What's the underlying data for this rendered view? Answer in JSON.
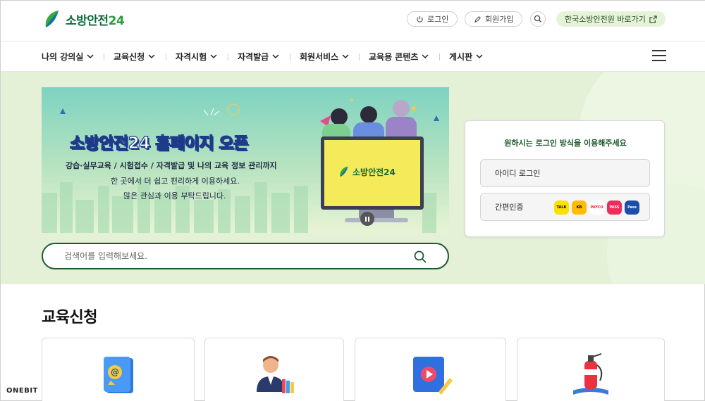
{
  "brand": {
    "name_ko": "소방안전",
    "name_num": "24"
  },
  "header": {
    "login_label": "로그인",
    "signup_label": "회원가입",
    "external_link_label": "한국소방안전원 바로가기"
  },
  "nav": {
    "items": [
      {
        "label": "나의 강의실"
      },
      {
        "label": "교육신청"
      },
      {
        "label": "자격시험"
      },
      {
        "label": "자격발급"
      },
      {
        "label": "회원서비스"
      },
      {
        "label": "교육용 콘텐츠"
      },
      {
        "label": "게시판"
      }
    ]
  },
  "banner": {
    "title": "소방안전24 홈페이지 오픈",
    "subtitle1": "강습·실무교육 / 시험접수 / 자격발급 및 나의 교육 정보 관리까지",
    "subtitle2": "한 곳에서 더 쉽고 편리하게 이용하세요.",
    "subtitle3": "많은 관심과 이용 부탁드립니다.",
    "monitor_brand": "소방안전24"
  },
  "search": {
    "placeholder": "검색어를 입력해보세요."
  },
  "login_card": {
    "title": "원하시는 로그인 방식을 이용해주세요",
    "id_login_label": "아이디 로그인",
    "simple_auth_label": "간편인증",
    "auth_providers": [
      {
        "name": "kakao",
        "label": "TALK",
        "color": "#fae100"
      },
      {
        "name": "kb",
        "label": "KB",
        "color": "#ffbc00"
      },
      {
        "name": "payco",
        "label": "PAYCO",
        "color": "#ff1e2e"
      },
      {
        "name": "pass",
        "label": "PASS",
        "color": "#ee2d5c"
      },
      {
        "name": "samsung-pass",
        "label": "Pass",
        "color": "#1b4ea8"
      }
    ]
  },
  "section": {
    "title": "교육신청"
  },
  "cards": [
    {
      "icon": "email-book-icon"
    },
    {
      "icon": "instructor-icon"
    },
    {
      "icon": "video-book-icon"
    },
    {
      "icon": "fire-extinguisher-icon"
    }
  ],
  "watermark": "ONEBIT"
}
